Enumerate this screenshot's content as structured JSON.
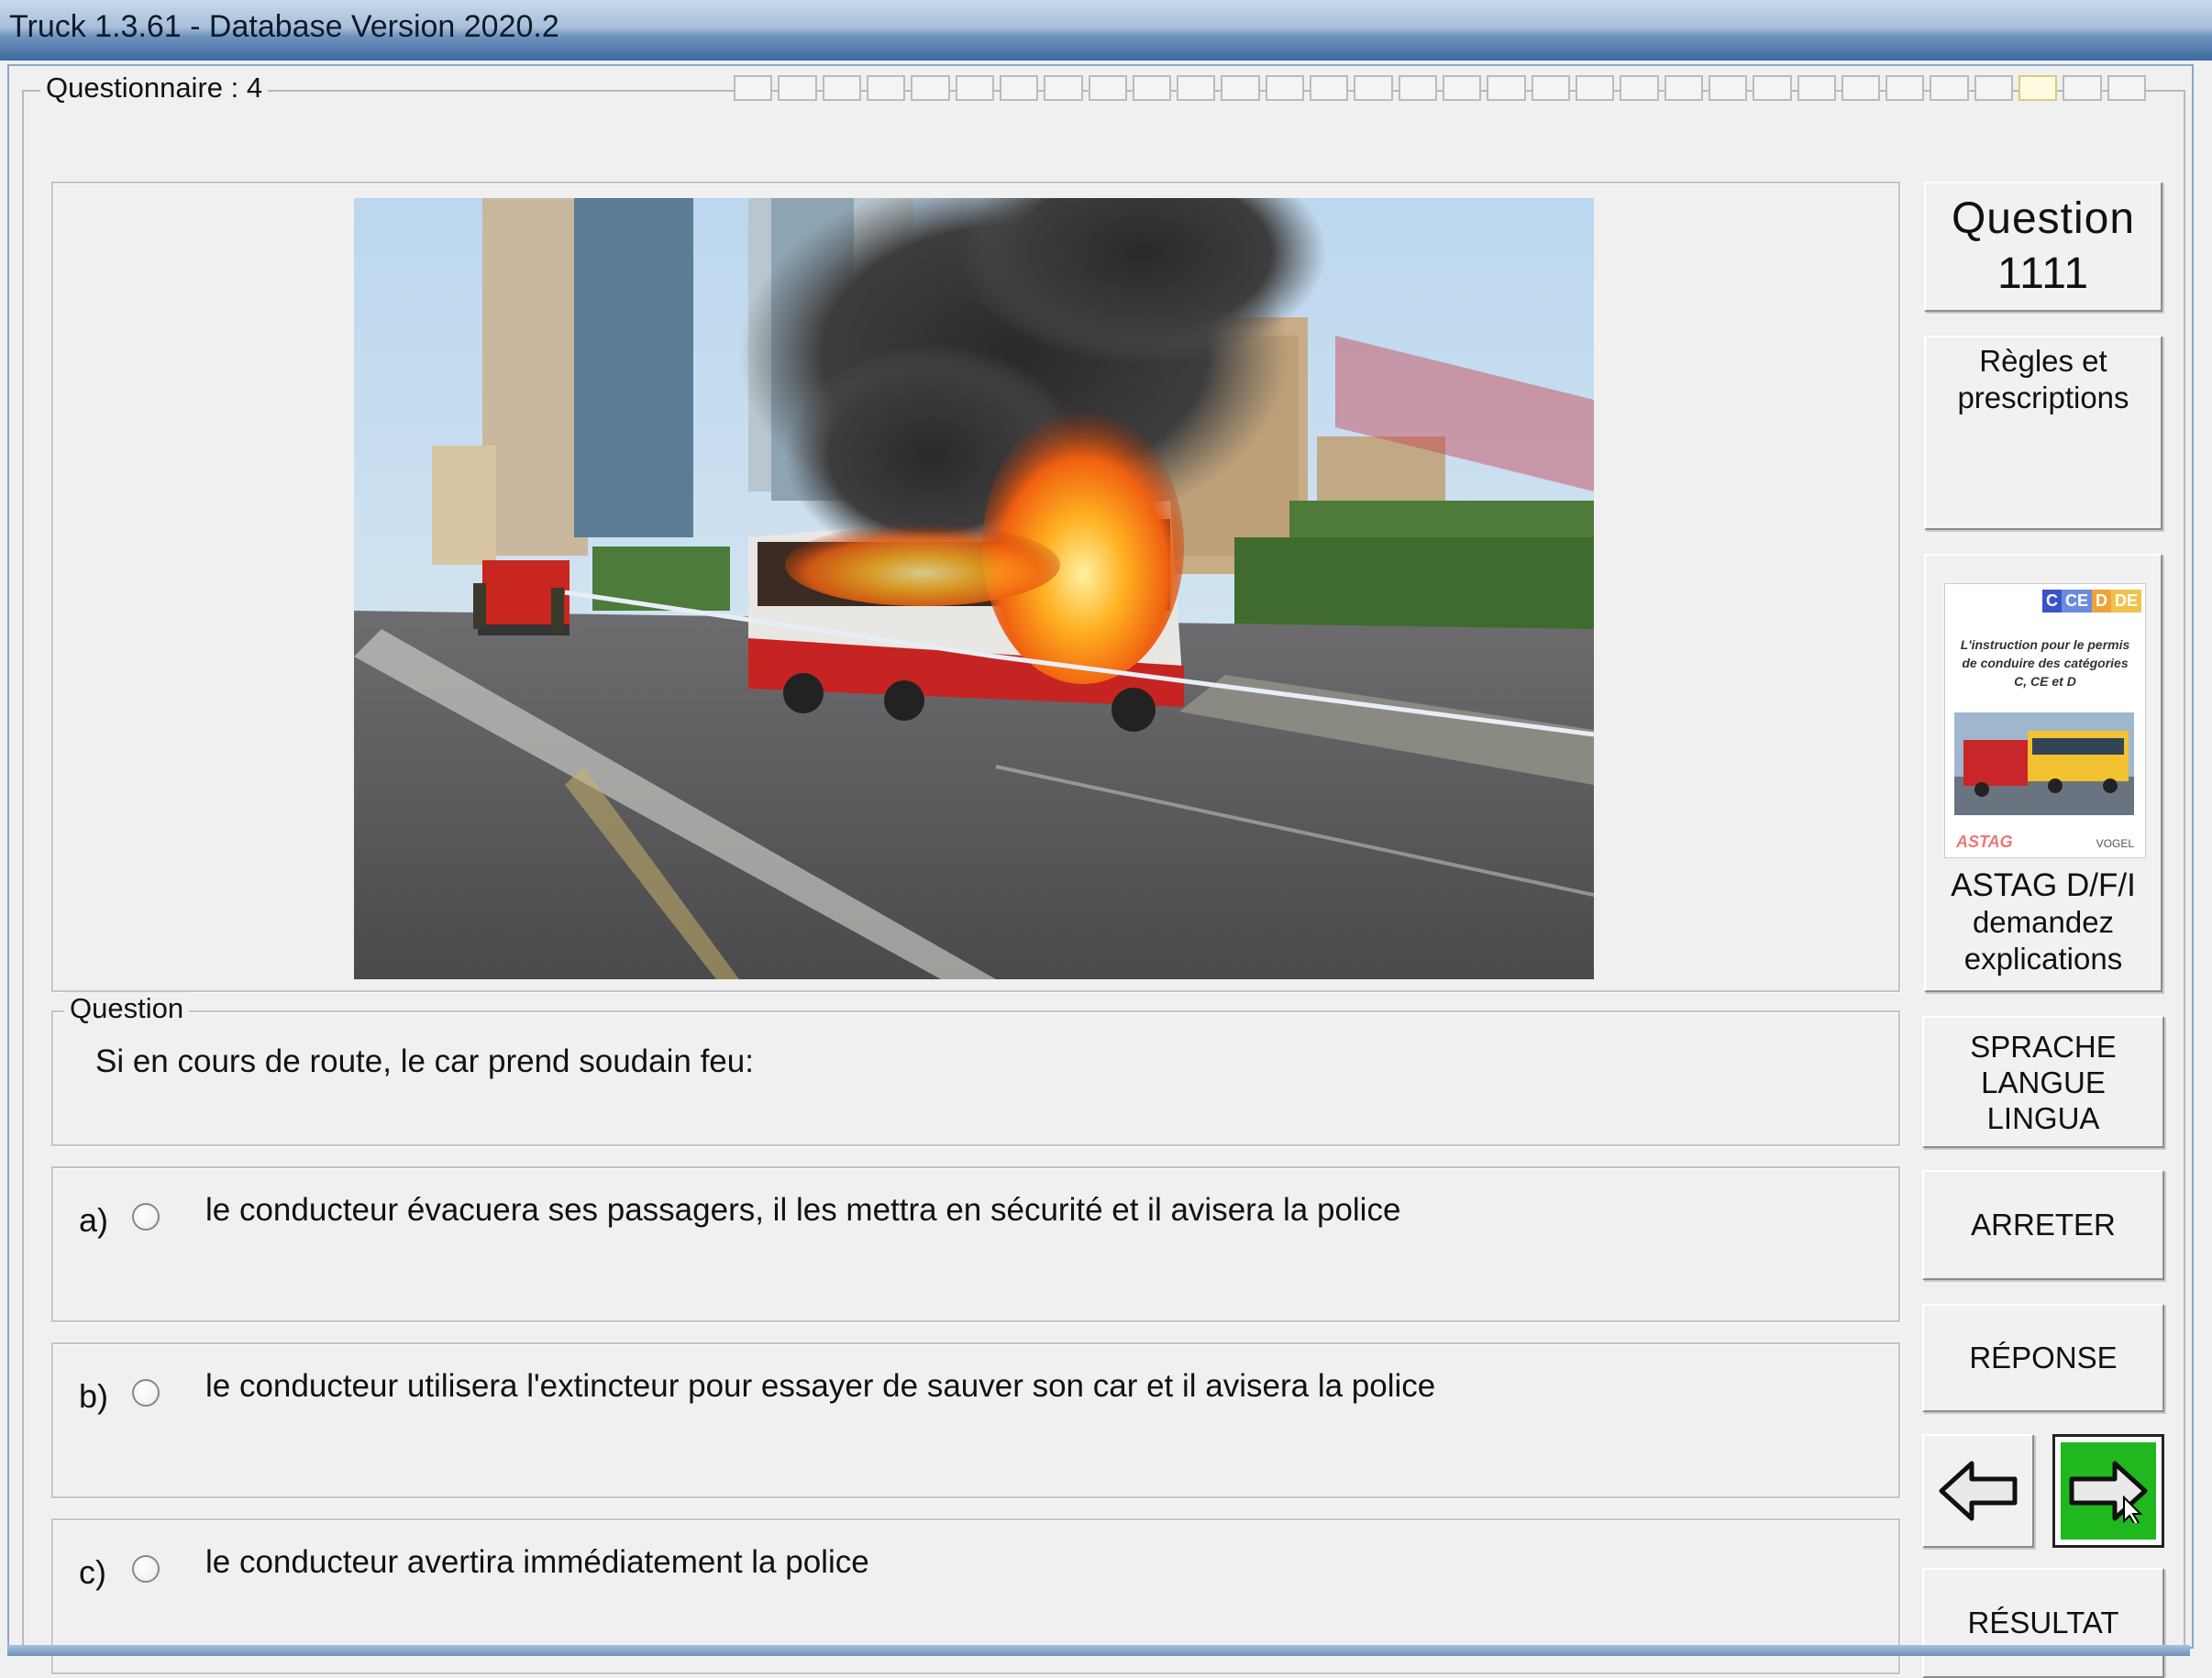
{
  "window": {
    "title": "Truck 1.3.61 - Database Version 2020.2"
  },
  "questionnaire": {
    "label": "Questionnaire : 4",
    "segments_total": 32,
    "segments_done": 0,
    "current_segment": 29
  },
  "question": {
    "number_label": "Question",
    "number": "1111",
    "category": "Règles et prescriptions",
    "section_label": "Question",
    "text": "Si en cours de route, le car prend soudain feu:",
    "image_alt": "bus on fire on a city road"
  },
  "answers": [
    {
      "letter": "a)",
      "text": "le conducteur évacuera ses passagers, il les mettra en sécurité et il avisera la police",
      "selected": false
    },
    {
      "letter": "b)",
      "text": "le conducteur utilisera l'extincteur pour essayer de sauver son car et il avisera la police",
      "selected": false
    },
    {
      "letter": "c)",
      "text": "le conducteur avertira immédiatement la police",
      "selected": false
    }
  ],
  "book": {
    "badges": [
      "C",
      "CE",
      "D",
      "DE"
    ],
    "cover_text": "L'instruction pour le permis de conduire des catégories C, CE et D",
    "logo_left": "ASTAG",
    "logo_right": "VOGEL",
    "caption_title": "ASTAG D/F/I",
    "caption_sub": "demandez explications"
  },
  "buttons": {
    "language": "SPRACHE LANGUE LINGUA",
    "stop": "ARRETER",
    "answer": "RÉPONSE",
    "result": "RÉSULTAT",
    "prev_icon": "arrow-left-icon",
    "next_icon": "arrow-right-icon"
  },
  "colors": {
    "next_button_bg": "#1fb81f",
    "titlebar": "#3e6aa0"
  }
}
